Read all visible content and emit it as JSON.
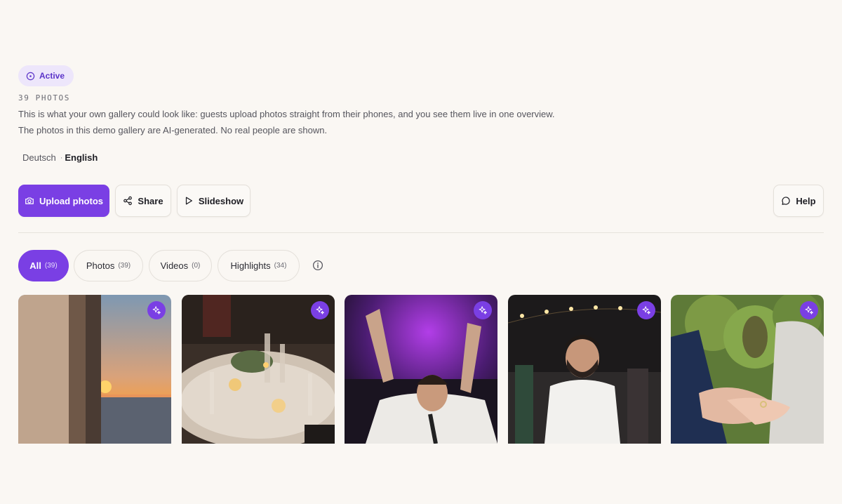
{
  "status": {
    "label": "Active"
  },
  "gallery": {
    "photo_count": "39 PHOTOS",
    "description_line1": "This is what your own gallery could look like: guests upload photos straight from their phones, and you see them live in one overview.",
    "description_line2": "The photos in this demo gallery are AI-generated. No real people are shown."
  },
  "languages": [
    {
      "label": "Deutsch",
      "active": false
    },
    {
      "label": "English",
      "active": true
    }
  ],
  "actions": {
    "upload_label": "Upload photos",
    "share_label": "Share",
    "slideshow_label": "Slideshow",
    "help_label": "Help"
  },
  "filters": [
    {
      "label": "All",
      "count": "(39)",
      "active": true
    },
    {
      "label": "Photos",
      "count": "(39)",
      "active": false
    },
    {
      "label": "Videos",
      "count": "(0)",
      "active": false
    },
    {
      "label": "Highlights",
      "count": "(34)",
      "active": false
    }
  ],
  "photos": [
    {
      "name": "sunset-over-sea",
      "highlight": true
    },
    {
      "name": "candlelit-table",
      "highlight": true
    },
    {
      "name": "dancing-guest",
      "highlight": true
    },
    {
      "name": "smiling-man-string-lights",
      "highlight": true
    },
    {
      "name": "ring-on-hand",
      "highlight": true
    }
  ],
  "colors": {
    "accent": "#7a3fe4",
    "background": "#faf7f3",
    "pill_background": "#ede6fb"
  }
}
